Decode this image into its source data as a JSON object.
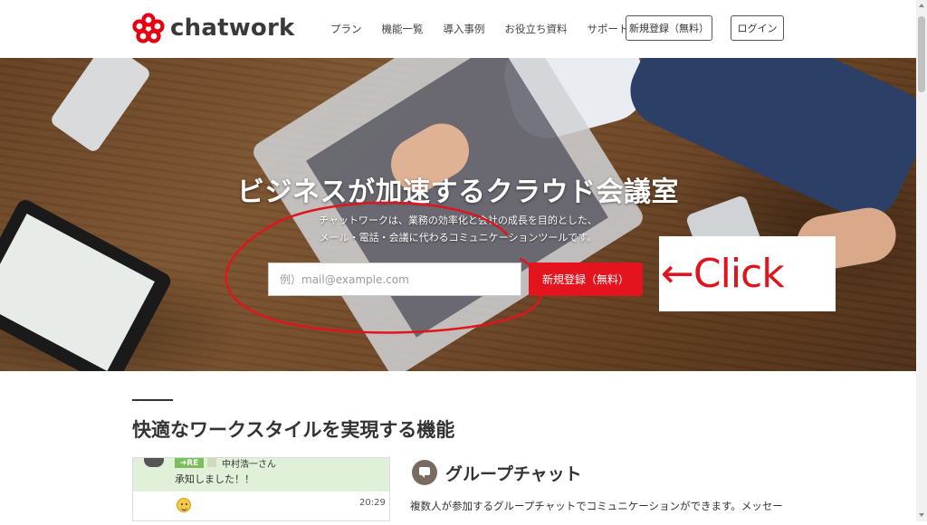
{
  "header": {
    "logo_text": "chatwork",
    "nav": [
      "プラン",
      "機能一覧",
      "導入事例",
      "お役立ち資料",
      "サポート"
    ],
    "signup_label": "新規登録（無料）",
    "login_label": "ログイン"
  },
  "hero": {
    "title": "ビジネスが加速するクラウド会議室",
    "subtitle_line1": "チャットワークは、業務の効率化と会社の成長を目的とした、",
    "subtitle_line2": "メール・電話・会議に代わるコミュニケーションツールです。",
    "email_placeholder": "例）mail@example.com",
    "cta_label": "新規登録（無料）"
  },
  "annotation": {
    "text": "←Click",
    "color": "#e0141c"
  },
  "features": {
    "section_title": "快適なワークスタイルを実現する機能",
    "chat_preview": {
      "badge": "RE",
      "mention": "中村浩一さん",
      "message": "承知しました！！",
      "time": "20:29"
    },
    "group_chat": {
      "title": "グループチャット",
      "description": "複数人が参加するグループチャットでコミュニケーションができます。メッセージの返信、引用、通知、学習機能や、設定方法を活用して、素早く正確に情報共有をすることができます。"
    }
  },
  "colors": {
    "brand_red": "#e3141e",
    "logo_red": "#e60012"
  }
}
